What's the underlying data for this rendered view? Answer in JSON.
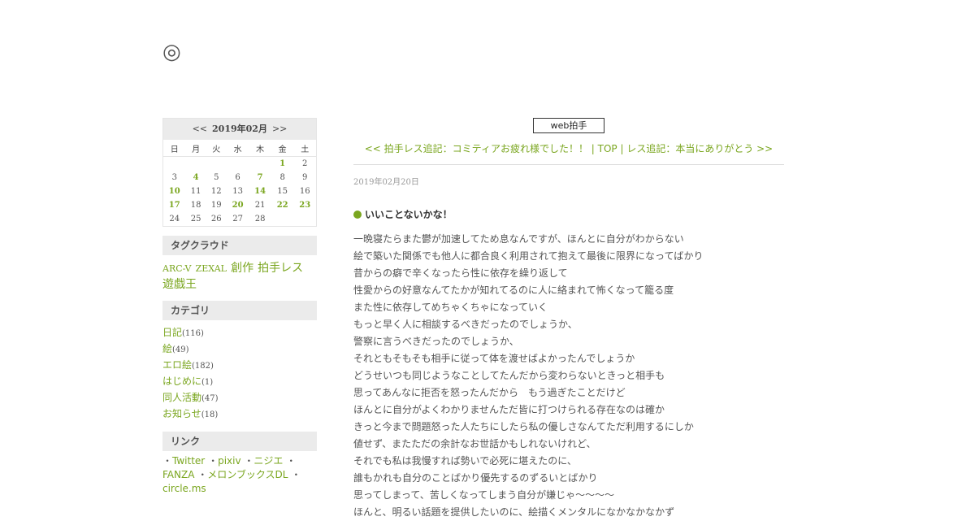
{
  "site": {
    "title": "◎"
  },
  "calendar": {
    "prev": "<<",
    "month": "2019年02月",
    "next": ">>",
    "weekdays": [
      "日",
      "月",
      "火",
      "水",
      "木",
      "金",
      "土"
    ],
    "weeks": [
      [
        "",
        "",
        "",
        "",
        "",
        "1",
        "2"
      ],
      [
        "3",
        "4",
        "5",
        "6",
        "7",
        "8",
        "9"
      ],
      [
        "10",
        "11",
        "12",
        "13",
        "14",
        "15",
        "16"
      ],
      [
        "17",
        "18",
        "19",
        "20",
        "21",
        "22",
        "23"
      ],
      [
        "24",
        "25",
        "26",
        "27",
        "28",
        "",
        ""
      ]
    ],
    "linked_days": [
      "1",
      "4",
      "7",
      "10",
      "14",
      "17",
      "20",
      "22",
      "23"
    ]
  },
  "tagcloud": {
    "heading": "タグクラウド",
    "tags": [
      {
        "label": "ARC-V",
        "size": "s"
      },
      {
        "label": "ZEXAL",
        "size": "s"
      },
      {
        "label": "創作",
        "size": "l"
      },
      {
        "label": "拍手レス",
        "size": "l"
      },
      {
        "label": "遊戯王",
        "size": "l"
      }
    ]
  },
  "categories": {
    "heading": "カテゴリ",
    "items": [
      {
        "label": "日記",
        "count": "(116)"
      },
      {
        "label": "絵",
        "count": "(49)"
      },
      {
        "label": "エロ絵",
        "count": "(182)"
      },
      {
        "label": "はじめに",
        "count": "(1)"
      },
      {
        "label": "同人活動",
        "count": "(47)"
      },
      {
        "label": "お知らせ",
        "count": "(18)"
      }
    ]
  },
  "links": {
    "heading": "リンク",
    "bullet": "・",
    "items": [
      "Twitter",
      "pixiv",
      "ニジエ",
      "FANZA",
      "メロンブックスDL",
      "circle.ms"
    ]
  },
  "main": {
    "clap_button": "web拍手",
    "nav": {
      "prev": "<< 拍手レス追記：コミティアお疲れ様でした！！",
      "sep1": " | ",
      "top": "TOP",
      "sep2": " | ",
      "next": "レス追記：本当にありがとう >>"
    },
    "date": "2019年02月20日",
    "title": "いいことないかな！",
    "body": [
      "一晩寝たらまた鬱が加速してため息なんですが、ほんとに自分がわからない",
      "絵で築いた関係でも他人に都合良く利用されて抱えて最後に限界になってばかり",
      "昔からの癖で辛くなったら性に依存を繰り返して",
      "性愛からの好意なんてたかが知れてるのに人に絡まれて怖くなって籠る度",
      "また性に依存してめちゃくちゃになっていく",
      "もっと早く人に相談するべきだったのでしょうか、",
      "警察に言うべきだったのでしょうか、",
      "それともそもそも相手に従って体を渡せばよかったんでしょうか",
      "どうせいつも同じようなことしてたんだから変わらないときっと相手も",
      "思ってあんなに拒否を怒ったんだから　もう過ぎたことだけど",
      "ほんとに自分がよくわかりませんただ皆に打つけられる存在なのは確か",
      "きっと今まで問題怒った人たちにしたら私の優しさなんてただ利用するにしか",
      "値せず、またただの余計なお世話かもしれないけれど、",
      "それでも私は我慢すれば勢いで必死に堪えたのに、",
      "誰もかれも自分のことばかり優先するのずるいとばかり",
      "思ってしまって、苦しくなってしまう自分が嫌じゃ～～～～",
      "ほんと、明るい話題を提供したいのに、絵描くメンタルになかなかなかず"
    ]
  },
  "colors": {
    "accent": "#7aa61f",
    "heading_bg": "#ebebeb",
    "text": "#555555"
  }
}
